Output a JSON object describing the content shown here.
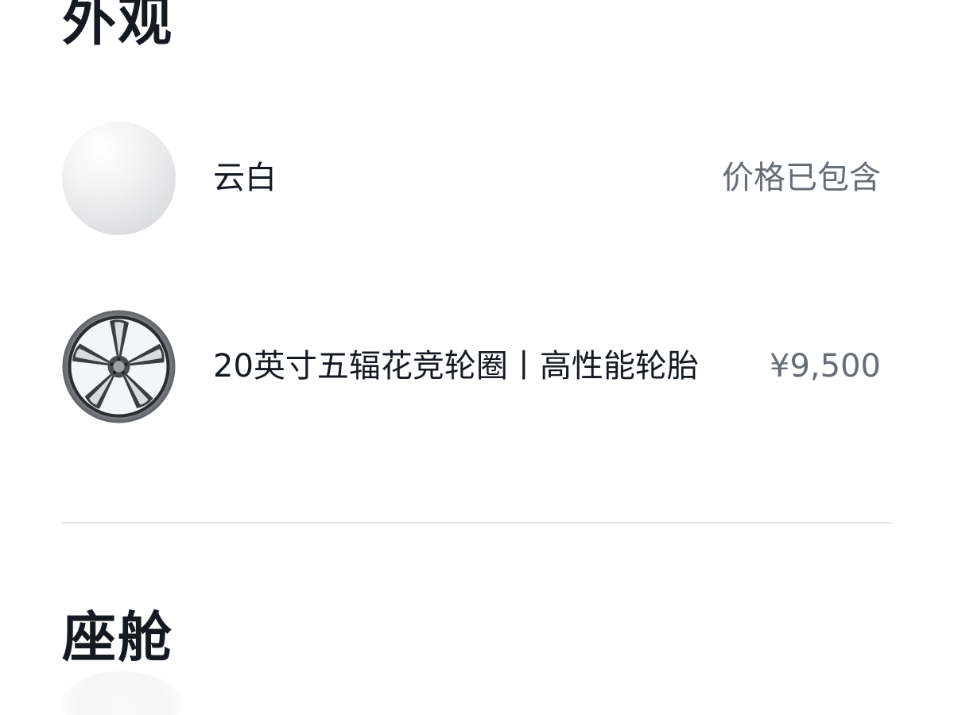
{
  "sections": {
    "exterior": {
      "title": "外观",
      "options": [
        {
          "name": "云白",
          "price": "价格已包含",
          "thumb_icon": "paint-swatch-icon"
        },
        {
          "name": "20英寸五辐花竞轮圈丨高性能轮胎",
          "price": "¥9,500",
          "thumb_icon": "wheel-rim-icon"
        }
      ]
    },
    "cabin": {
      "title": "座舱"
    }
  },
  "colors": {
    "text_primary": "#151a22",
    "text_secondary": "#666d76",
    "divider": "#e6e7e9",
    "background": "#ffffff"
  }
}
